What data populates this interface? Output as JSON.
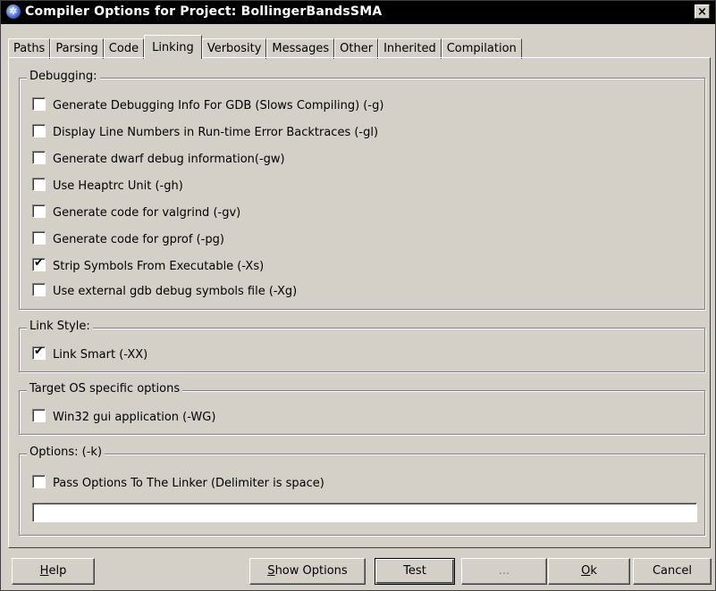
{
  "window": {
    "title": "Compiler Options for Project: BollingerBandsSMA",
    "close_glyph": "×"
  },
  "tabs": [
    {
      "label": "Paths",
      "active": false
    },
    {
      "label": "Parsing",
      "active": false
    },
    {
      "label": "Code",
      "active": false
    },
    {
      "label": "Linking",
      "active": true
    },
    {
      "label": "Verbosity",
      "active": false
    },
    {
      "label": "Messages",
      "active": false
    },
    {
      "label": "Other",
      "active": false
    },
    {
      "label": "Inherited",
      "active": false
    },
    {
      "label": "Compilation",
      "active": false
    }
  ],
  "debugging": {
    "title": "Debugging:",
    "items": [
      {
        "label": "Generate Debugging Info For GDB (Slows Compiling) (-g)",
        "checked": false
      },
      {
        "label": "Display Line Numbers in Run-time Error Backtraces (-gl)",
        "checked": false
      },
      {
        "label": "Generate dwarf debug information(-gw)",
        "checked": false
      },
      {
        "label": "Use Heaptrc Unit (-gh)",
        "checked": false
      },
      {
        "label": "Generate code for valgrind (-gv)",
        "checked": false
      },
      {
        "label": "Generate code for gprof (-pg)",
        "checked": false
      },
      {
        "label": "Strip Symbols From Executable (-Xs)",
        "checked": true
      },
      {
        "label": "Use external gdb debug symbols file (-Xg)",
        "checked": false
      }
    ]
  },
  "link_style": {
    "title": "Link Style:",
    "items": [
      {
        "label": "Link Smart (-XX)",
        "checked": true
      }
    ]
  },
  "target_os": {
    "title": "Target OS specific options",
    "items": [
      {
        "label": "Win32 gui application (-WG)",
        "checked": false
      }
    ]
  },
  "options": {
    "title": "Options: (-k)",
    "pass_label": "Pass Options To The Linker (Delimiter is space)",
    "pass_checked": false,
    "field_value": ""
  },
  "buttons": {
    "help": {
      "accel": "H",
      "rest": "elp"
    },
    "show_options": {
      "accel": "S",
      "rest": "how Options"
    },
    "test": "Test",
    "ellipsis": "...",
    "ok": {
      "accel": "O",
      "rest": "k"
    },
    "cancel": "Cancel"
  },
  "check_glyph": "✔"
}
